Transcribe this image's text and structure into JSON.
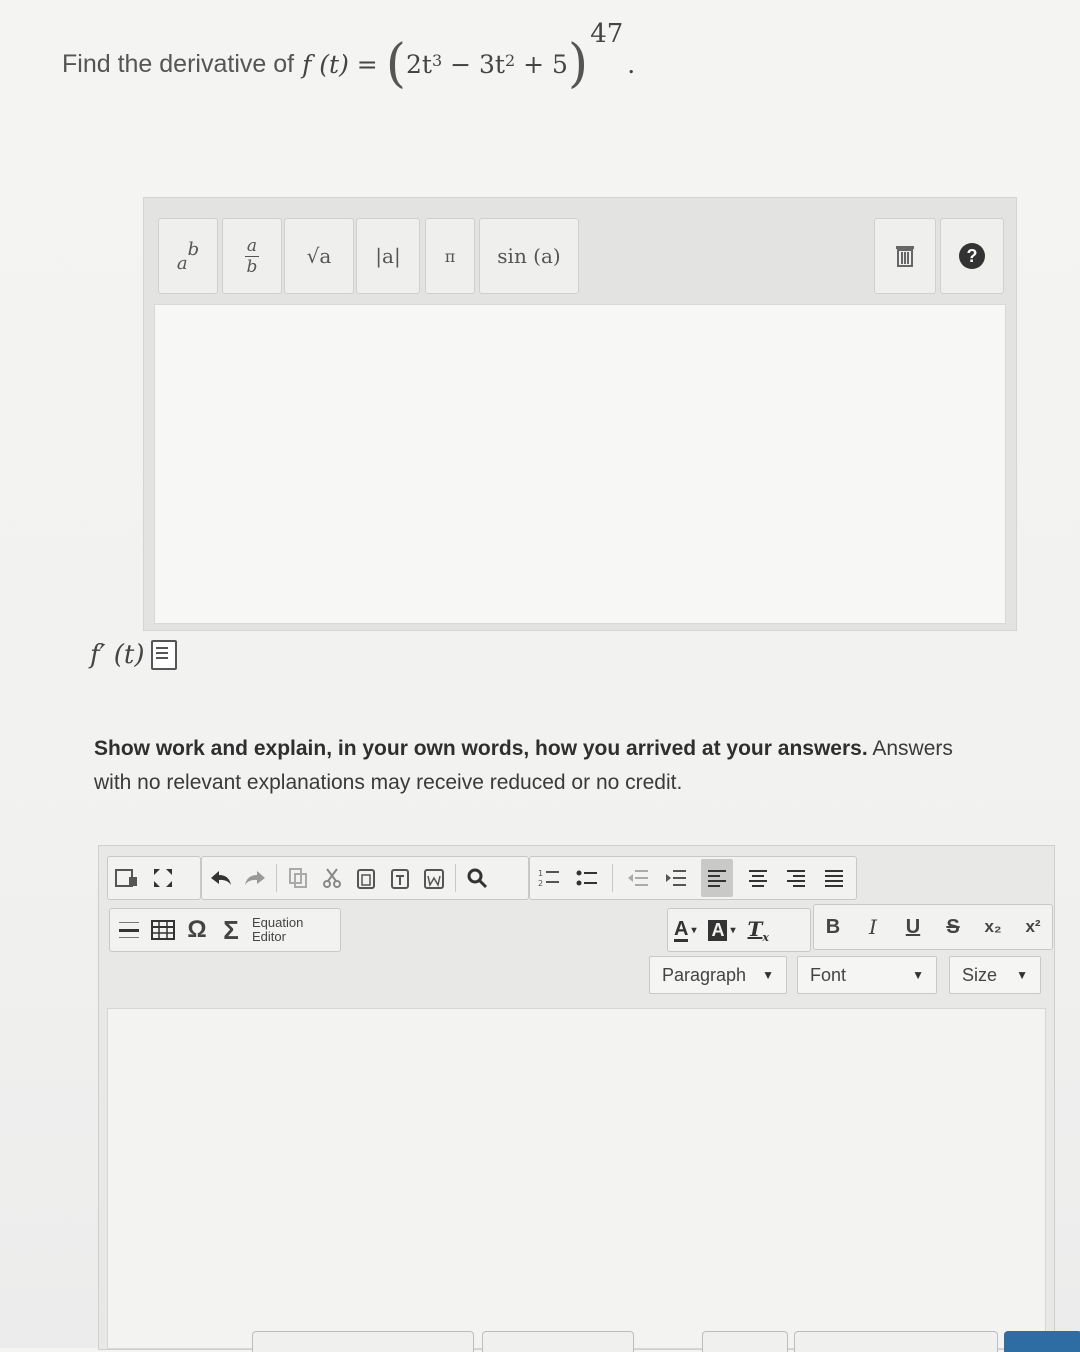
{
  "question": {
    "prefix": "Find the derivative of",
    "func": "f (t) =",
    "open_paren": "(",
    "term1": "2t",
    "term1_exp": "3",
    "minus": "−",
    "term2": "3t",
    "term2_exp": "2",
    "plus": "+",
    "term3": "5",
    "close_paren": ")",
    "outer_exp": "47",
    "end": "."
  },
  "equation_toolbar": {
    "buttons": [
      "a^b",
      "a/b",
      "√a",
      "|a|",
      "π",
      "sin (a)"
    ],
    "power_base": "a",
    "power_exp": "b",
    "frac_num": "a",
    "frac_den": "b",
    "sqrt_label": "√a",
    "abs_label": "|a|",
    "pi_label": "π",
    "sin_label": "sin (a)",
    "trash_icon": "trash-icon",
    "help_icon": "help-icon",
    "help_label": "?"
  },
  "answer_label": {
    "text": "f′ (t)"
  },
  "instructions": {
    "bold": "Show work and explain, in your own words, how you arrived at your answers.",
    "normal": " Answers with no relevant explanations may receive reduced or no credit."
  },
  "rich_editor": {
    "equation_editor_line1": "Equation",
    "equation_editor_line2": "Editor",
    "omega": "Ω",
    "sigma": "Σ",
    "text_color": "A",
    "bg_color": "A",
    "clear_format": "T",
    "bold": "B",
    "italic": "I",
    "underline": "U",
    "strike": "S",
    "subscript": "x₂",
    "superscript": "x²",
    "format_dropdown": "Paragraph",
    "font_dropdown": "Font",
    "size_dropdown": "Size"
  }
}
